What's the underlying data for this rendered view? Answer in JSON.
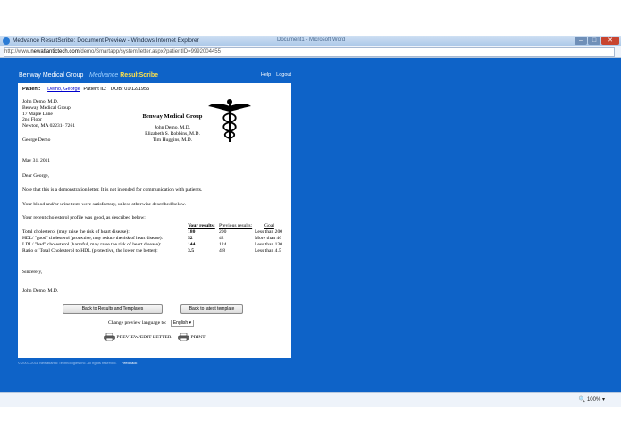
{
  "window": {
    "title": "Medvance ResultScribe: Document Preview - Windows Internet Explorer",
    "other_tasks": [
      "Document1 - Microsoft Word"
    ],
    "url_prefix": "http://www.",
    "url_domain": "newatlantictech.com",
    "url_rest": "/demo/Smartapp/system/letter.aspx?patientID=9992004455",
    "zoom": "100%"
  },
  "app": {
    "group": "Benway Medical Group",
    "brand_a": "Medvance ",
    "brand_b": "ResultScribe",
    "help": "Help",
    "logout": "Logout"
  },
  "patient": {
    "label": "Patient:",
    "name": "Demo, George",
    "id_label": "Patient ID:",
    "dob": "DOB: 01/12/1955"
  },
  "sender": {
    "lines": [
      "John Demo, M.D.",
      "Benway Medical Group",
      "17 Maple Lane",
      "2nd Floor",
      "Newton, MA 02231- 7261"
    ]
  },
  "letterhead": {
    "org": "Benway Medical Group",
    "doctors": [
      "John Demo, M.D.",
      "Elizabeth S. Robbins, M.D.",
      "Tim Huggins, M.D."
    ]
  },
  "recipient": {
    "name": "George Demo",
    "mark": "-"
  },
  "date": "May 31, 2011",
  "salutation": "Dear George,",
  "paragraphs": [
    "Note that this is a demonstration letter. It is not intended for communication with patients.",
    "Your blood and/or urine tests were satisfactory, unless otherwise described below.",
    "Your recent cholesterol profile was good, as described below:"
  ],
  "results": {
    "headers": [
      "Your results:",
      "Previous results:",
      "Goal"
    ],
    "rows": [
      {
        "label": "Total cholesterol (may raise the risk of heart disease):",
        "yours": "180",
        "prev": "200",
        "goal": "Less than 200"
      },
      {
        "label": "HDL/ \"good\" cholesterol (protective, may reduce the risk of heart disease):",
        "yours": "52",
        "prev": "42",
        "goal": "More than 40"
      },
      {
        "label": "LDL/ \"bad\" cholesterol (harmful, may raise the risk of heart disease):",
        "yours": "144",
        "prev": "124",
        "goal": "Less than 130"
      },
      {
        "label": "Ratio of Total Cholesterol to HDL (protective, the lower the better):",
        "yours": "3.5",
        "prev": "4.8",
        "goal": "Less than 4.5"
      }
    ]
  },
  "closing": "Sincerely,",
  "signature": "John Demo, M.D.",
  "buttons": {
    "back_results": "Back to Results and Templates",
    "back_template": "Back to latest template"
  },
  "language": {
    "label": "Change preview language to:",
    "value": "English"
  },
  "actions": {
    "preview": "PREVIEW/EDIT LETTER",
    "print": "PRINT"
  },
  "footer": {
    "text": "© 2007-2011 Newatlantic Technologies Inc. All rights reserved.",
    "link": "Feedback"
  },
  "colors": {
    "desktop": "#0e63c8",
    "brand_b": "#ffe24a",
    "brand_a": "#9fd1ff"
  }
}
